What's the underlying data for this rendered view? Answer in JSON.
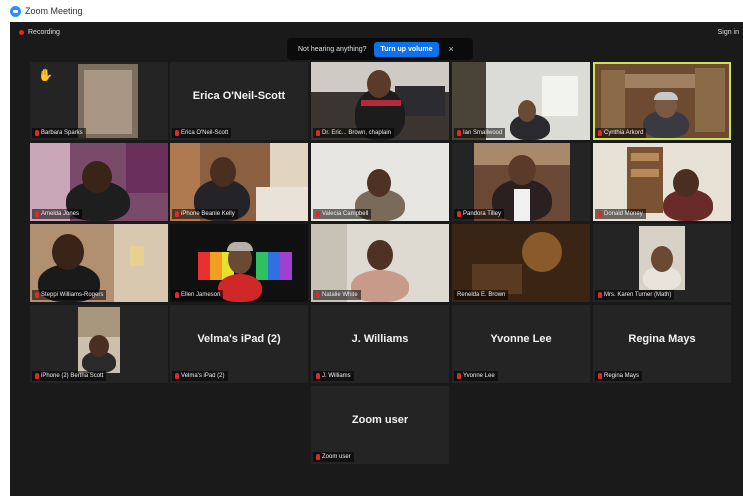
{
  "window": {
    "title": "Zoom Meeting"
  },
  "toolbar": {
    "recording_label": "Recording",
    "signin_label": "Sign in"
  },
  "notice": {
    "text": "Not hearing anything?",
    "button_label": "Turn up volume",
    "close_symbol": "×"
  },
  "raised_hand_symbol": "✋",
  "participants": [
    {
      "name": "Barbara Sparks",
      "display": "",
      "video": true,
      "muted": true,
      "hand_raised": true
    },
    {
      "name": "Erica O'Neil-Scott",
      "display": "Erica O'Neil-Scott",
      "video": false,
      "muted": true
    },
    {
      "name": "Dr. Eric... Brown, chaplain",
      "display": "",
      "video": true,
      "muted": true
    },
    {
      "name": "Ian Smallwood",
      "display": "",
      "video": true,
      "muted": true
    },
    {
      "name": "Cynthia Arkord",
      "display": "",
      "video": true,
      "muted": true,
      "active_speaker": true
    },
    {
      "name": "Amelda Jones",
      "display": "",
      "video": true,
      "muted": true
    },
    {
      "name": "iPhone Beanie Kelly",
      "display": "",
      "video": true,
      "muted": true
    },
    {
      "name": "Valecia Campbell",
      "display": "",
      "video": true,
      "muted": true
    },
    {
      "name": "Pandora Tilley",
      "display": "",
      "video": true,
      "muted": true
    },
    {
      "name": "Donald Money",
      "display": "",
      "video": true,
      "muted": true
    },
    {
      "name": "Steppi Williams-Rogers",
      "display": "",
      "video": true,
      "muted": true
    },
    {
      "name": "Ellen Jameson",
      "display": "",
      "video": true,
      "muted": true
    },
    {
      "name": "Natalie White",
      "display": "",
      "video": true,
      "muted": true
    },
    {
      "name": "Renelda E. Brown",
      "display": "",
      "video": true,
      "muted": false
    },
    {
      "name": "Mrs. Karen Turner (Math)",
      "display": "",
      "video": true,
      "muted": true
    },
    {
      "name": "iPhone (2) Bertha Scott",
      "display": "",
      "video": true,
      "muted": true
    },
    {
      "name": "Velma's iPad (2)",
      "display": "Velma's iPad (2)",
      "video": false,
      "muted": true
    },
    {
      "name": "J. Williams",
      "display": "J. Williams",
      "video": false,
      "muted": true
    },
    {
      "name": "Yvonne Lee",
      "display": "Yvonne Lee",
      "video": false,
      "muted": true
    },
    {
      "name": "Regina Mays",
      "display": "Regina Mays",
      "video": false,
      "muted": true
    },
    {
      "name": "Zoom user",
      "display": "Zoom user",
      "video": false,
      "muted": true
    }
  ],
  "colors": {
    "accent": "#0e71eb",
    "active_border": "#c8e25a",
    "muted_mic": "#e02828",
    "background": "#1a1a1a"
  }
}
